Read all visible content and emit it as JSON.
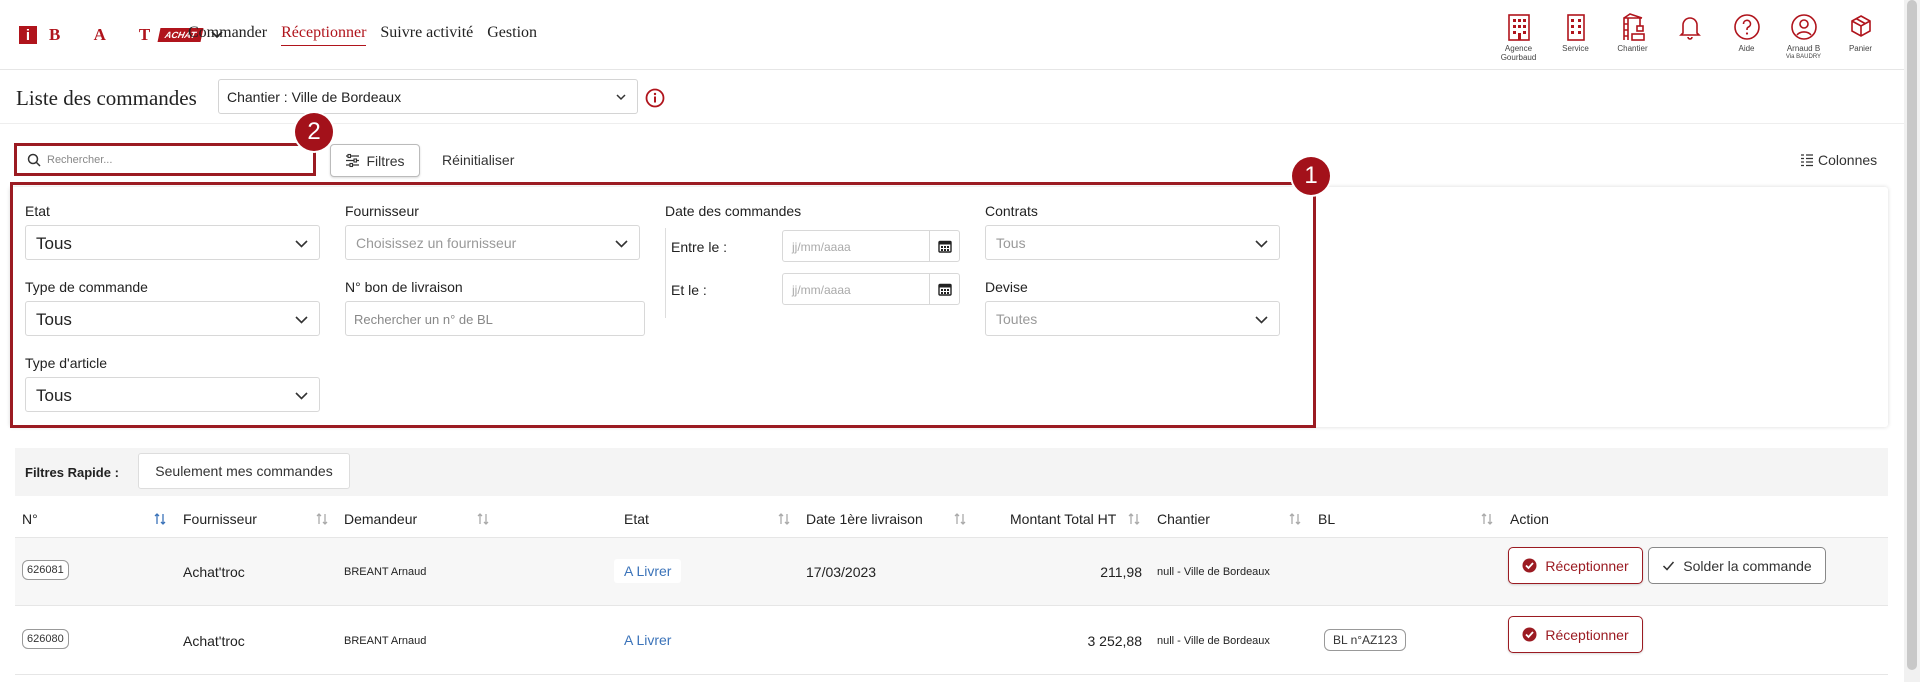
{
  "header": {
    "logo_letters": "B A T",
    "logo_i": "i",
    "logo_tag": "ACHAT",
    "nav": [
      "Commander",
      "Réceptionner",
      "Suivre activité",
      "Gestion"
    ],
    "active_nav": "Réceptionner",
    "icons": [
      {
        "icon": "building-icon",
        "label": "Agence",
        "sub": "Gourbaud"
      },
      {
        "icon": "office-building-icon",
        "label": "Service",
        "sub": ""
      },
      {
        "icon": "crane-icon",
        "label": "Chantier",
        "sub": ""
      },
      {
        "icon": "bell-icon",
        "label": "",
        "sub": ""
      },
      {
        "icon": "help-icon",
        "label": "Aide",
        "sub": ""
      },
      {
        "icon": "user-icon",
        "label": "Arnaud B",
        "sub": "Via BAUDRY"
      },
      {
        "icon": "cart-icon",
        "label": "Panier",
        "sub": ""
      }
    ]
  },
  "page": {
    "title": "Liste des commandes",
    "chantier_select": "Chantier : Ville de Bordeaux"
  },
  "toolbar": {
    "search_placeholder": "Rechercher...",
    "filters_label": "Filtres",
    "reset_label": "Réinitialiser",
    "columns_label": "Colonnes",
    "badge_1": "1",
    "badge_2": "2"
  },
  "filters": {
    "etat_label": "Etat",
    "etat_value": "Tous",
    "fournisseur_label": "Fournisseur",
    "fournisseur_placeholder": "Choisissez un fournisseur",
    "date_label": "Date des commandes",
    "entre_label": "Entre le :",
    "et_label": "Et le :",
    "date_placeholder": "jj/mm/aaaa",
    "contrats_label": "Contrats",
    "contrats_value": "Tous",
    "type_commande_label": "Type de commande",
    "type_commande_value": "Tous",
    "bl_label": "N° bon de livraison",
    "bl_placeholder": "Rechercher un n° de BL",
    "devise_label": "Devise",
    "devise_value": "Toutes",
    "type_article_label": "Type d'article",
    "type_article_value": "Tous"
  },
  "quick_filters": {
    "label": "Filtres Rapide :",
    "button": "Seulement mes commandes"
  },
  "table": {
    "columns": [
      "N°",
      "Fournisseur",
      "Demandeur",
      "Etat",
      "Date 1ère livraison",
      "Montant Total HT",
      "Chantier",
      "BL",
      "Action"
    ],
    "rows": [
      {
        "num": "626081",
        "fournisseur": "Achat'troc",
        "demandeur": "BREANT Arnaud",
        "etat": "A Livrer",
        "date": "17/03/2023",
        "montant": "211,98",
        "chantier": "null - Ville de Bordeaux",
        "bl": "",
        "action_primary": "Réceptionner",
        "action_secondary": "Solder la commande"
      },
      {
        "num": "626080",
        "fournisseur": "Achat'troc",
        "demandeur": "BREANT Arnaud",
        "etat": "A Livrer",
        "date": "",
        "montant": "3 252,88",
        "chantier": "null - Ville de Bordeaux",
        "bl": "BL n°AZ123",
        "action_primary": "Réceptionner",
        "action_secondary": ""
      }
    ]
  },
  "colors": {
    "brand": "#b0141c",
    "highlight": "#9b1b22",
    "etat_blue": "#3b73b9"
  }
}
